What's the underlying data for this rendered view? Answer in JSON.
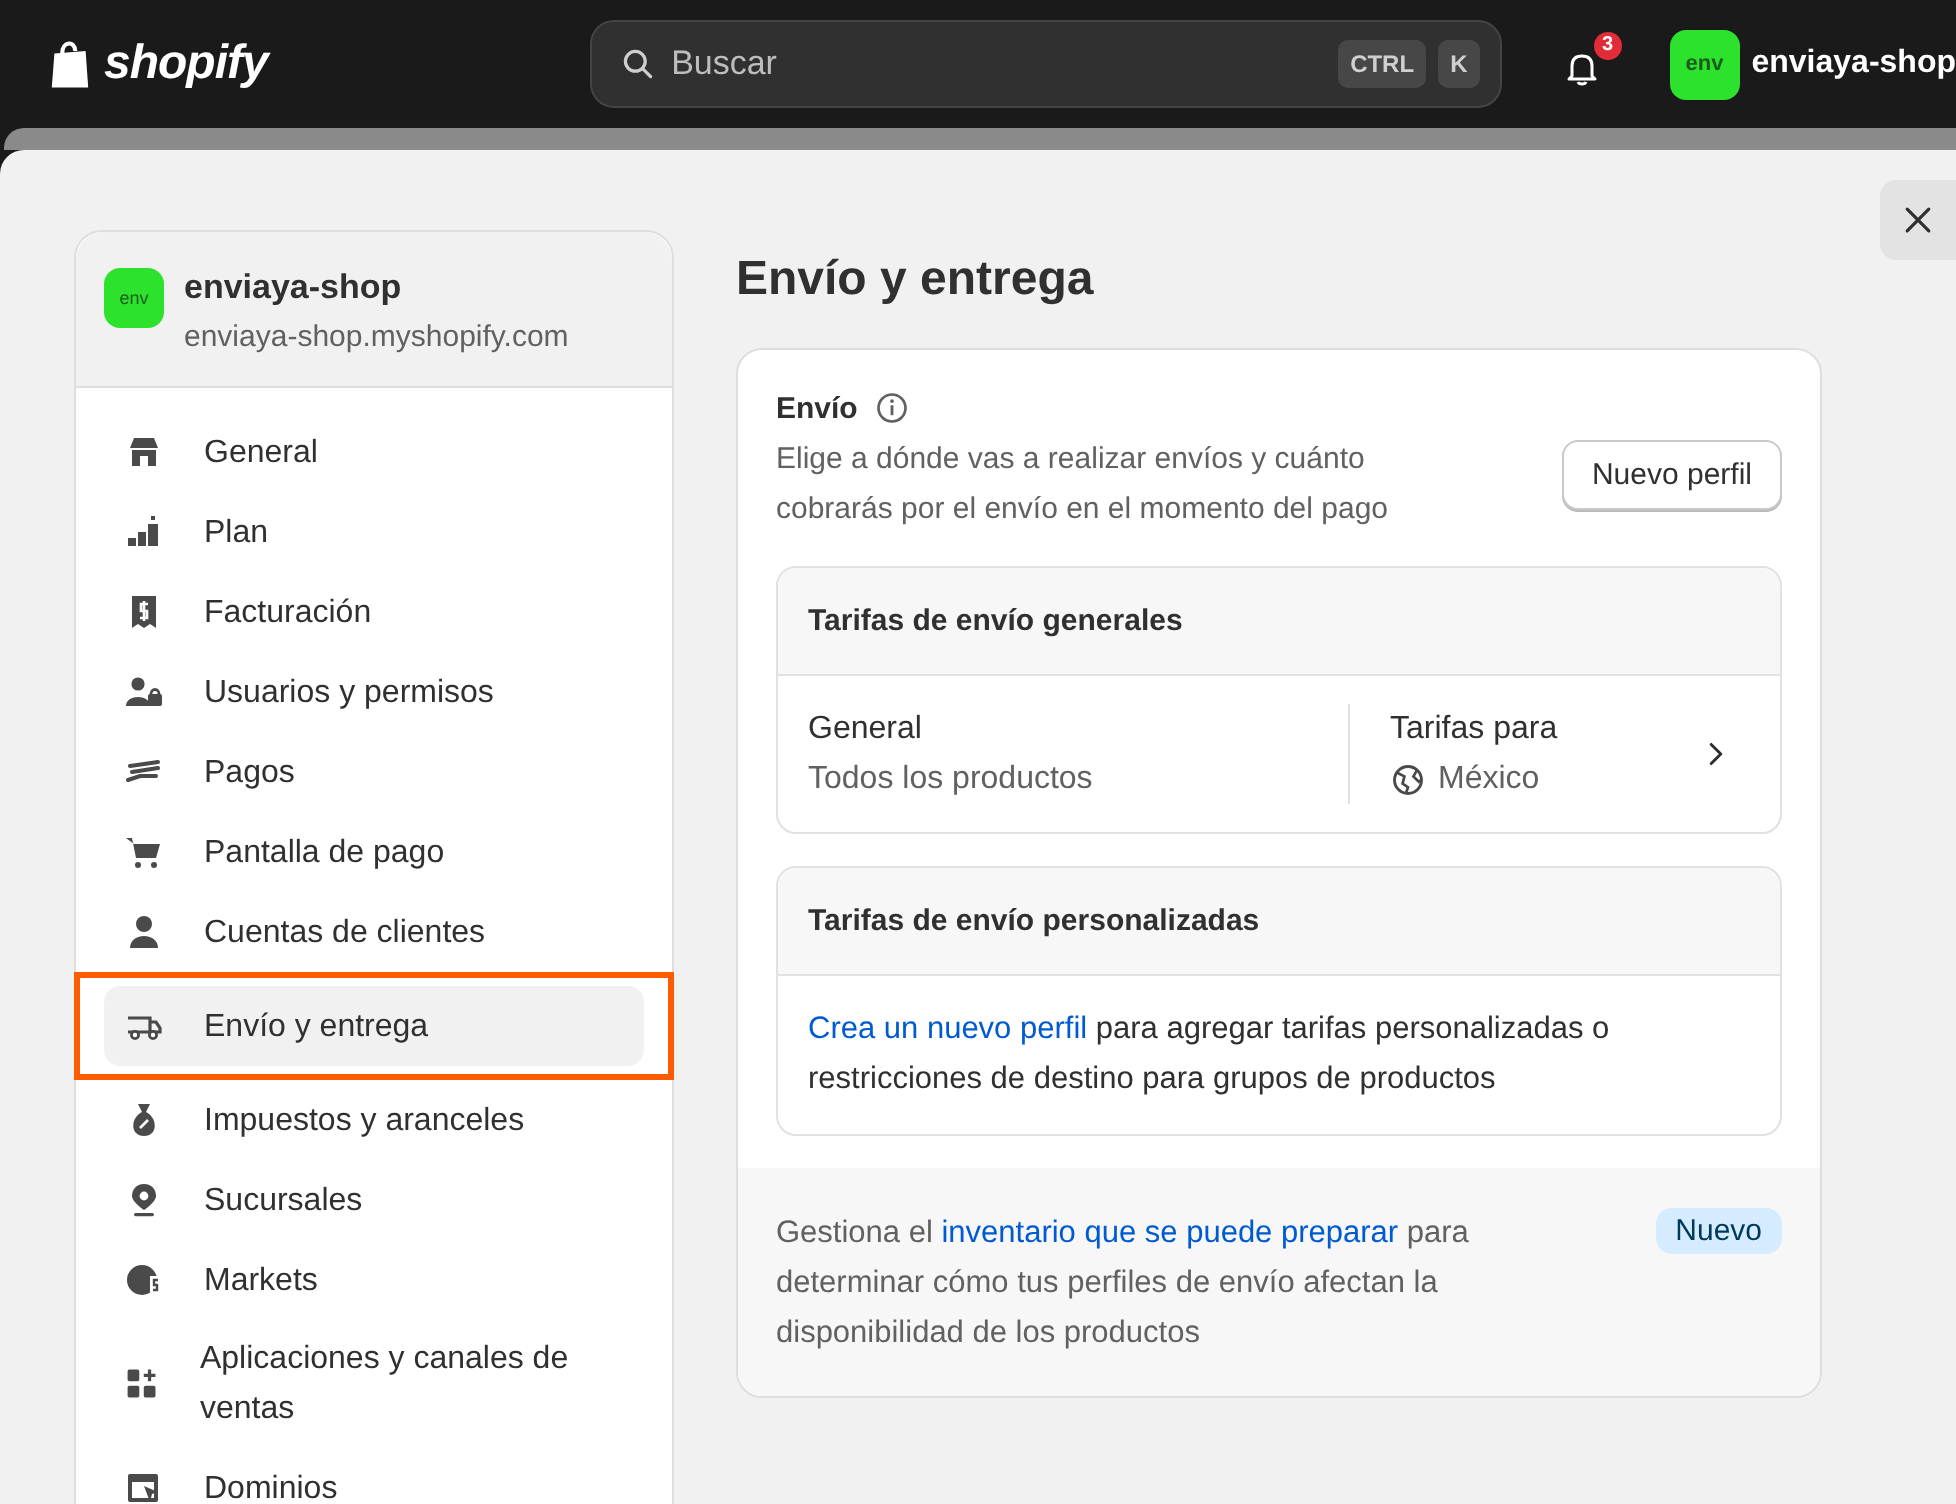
{
  "topbar": {
    "logo": "shopify",
    "search": {
      "placeholder": "Buscar",
      "keys": [
        "CTRL",
        "K"
      ]
    },
    "notifications": "3",
    "store": {
      "avatar": "env",
      "name": "enviaya-shop"
    }
  },
  "sidebar": {
    "store": {
      "avatar": "env",
      "name": "enviaya-shop",
      "domain": "enviaya-shop.myshopify.com"
    },
    "items": [
      {
        "label": "General",
        "selected": false
      },
      {
        "label": "Plan",
        "selected": false
      },
      {
        "label": "Facturación",
        "selected": false
      },
      {
        "label": "Usuarios y permisos",
        "selected": false
      },
      {
        "label": "Pagos",
        "selected": false
      },
      {
        "label": "Pantalla de pago",
        "selected": false
      },
      {
        "label": "Cuentas de clientes",
        "selected": false
      },
      {
        "label": "Envío y entrega",
        "selected": true
      },
      {
        "label": "Impuestos y aranceles",
        "selected": false
      },
      {
        "label": "Sucursales",
        "selected": false
      },
      {
        "label": "Markets",
        "selected": false
      },
      {
        "label": "Aplicaciones y canales de ventas",
        "selected": false
      },
      {
        "label": "Dominios",
        "selected": false
      }
    ]
  },
  "page": {
    "title": "Envío y entrega",
    "shipping": {
      "title": "Envío",
      "description": "Elige a dónde vas a realizar envíos y cuánto cobrarás por el envío en el momento del pago",
      "button": "Nuevo perfil",
      "general_rates": {
        "title": "Tarifas de envío generales",
        "profile": "General",
        "products": "Todos los productos",
        "rates_label": "Tarifas para",
        "country": "México"
      },
      "custom_rates": {
        "title": "Tarifas de envío personalizadas",
        "link": "Crea un nuevo perfil",
        "text": " para agregar tarifas personalizadas o restricciones de destino para grupos de productos"
      },
      "footer": {
        "before": "Gestiona el ",
        "link": "inventario que se puede preparar",
        "after": " para determinar cómo tus perfiles de envío afectan la disponibilidad de los productos",
        "badge": "Nuevo"
      }
    }
  }
}
